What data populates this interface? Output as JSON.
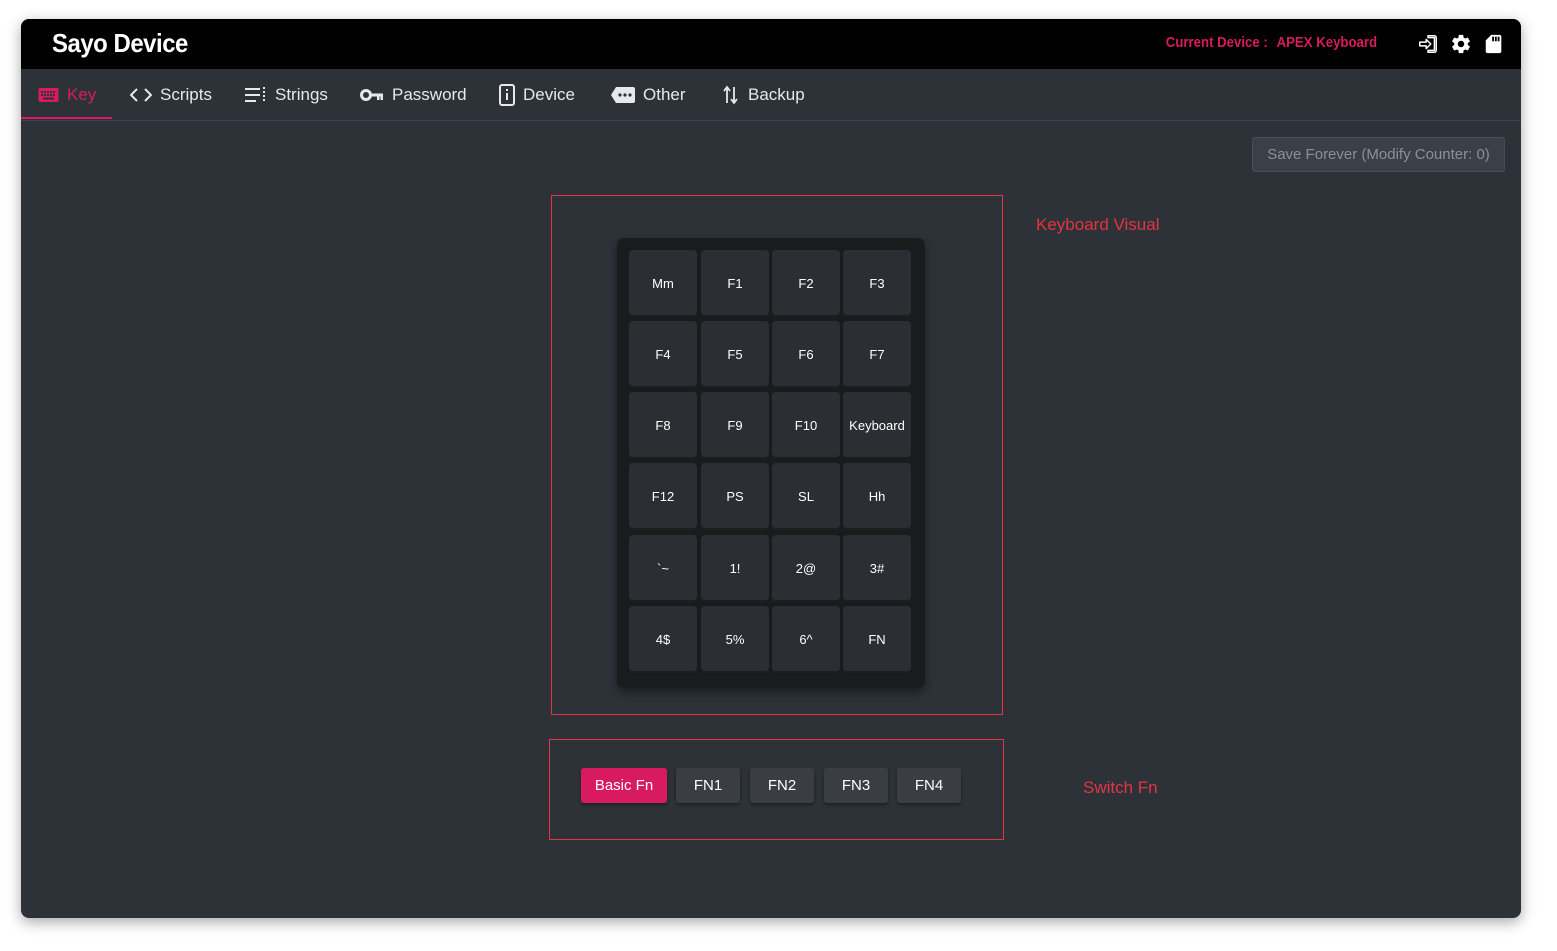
{
  "app": {
    "title": "Sayo Device",
    "device_label": "Current Device :",
    "device_name": "APEX Keyboard"
  },
  "titlebar_icons": [
    "login-icon",
    "gear-icon",
    "sd-card-icon"
  ],
  "tabs": [
    {
      "label": "Key",
      "icon": "keyboard-icon",
      "active": true
    },
    {
      "label": "Scripts",
      "icon": "code-icon",
      "active": false
    },
    {
      "label": "Strings",
      "icon": "list-icon",
      "active": false
    },
    {
      "label": "Password",
      "icon": "key-icon",
      "active": false
    },
    {
      "label": "Device",
      "icon": "device-icon",
      "active": false
    },
    {
      "label": "Other",
      "icon": "more-icon",
      "active": false
    },
    {
      "label": "Backup",
      "icon": "swap-vertical-icon",
      "active": false
    }
  ],
  "save_button": "Save Forever (Modify Counter: 0)",
  "annotations": {
    "keyboard_visual": "Keyboard Visual",
    "switch_fn": "Switch Fn"
  },
  "keys": [
    [
      "Mm",
      "F1",
      "F2",
      "F3"
    ],
    [
      "F4",
      "F5",
      "F6",
      "F7"
    ],
    [
      "F8",
      "F9",
      "F10",
      "Keyboard"
    ],
    [
      "F12",
      "PS",
      "SL",
      "Hh"
    ],
    [
      "`~",
      "1!",
      "2@",
      "3#"
    ],
    [
      "4$",
      "5%",
      "6^",
      "FN"
    ]
  ],
  "fn_buttons": [
    {
      "label": "Basic Fn",
      "active": true
    },
    {
      "label": "FN1",
      "active": false
    },
    {
      "label": "FN2",
      "active": false
    },
    {
      "label": "FN3",
      "active": false
    },
    {
      "label": "FN4",
      "active": false
    }
  ],
  "colors": {
    "accent": "#d81b60",
    "annotation": "#e53340",
    "background": "#2d3239"
  }
}
